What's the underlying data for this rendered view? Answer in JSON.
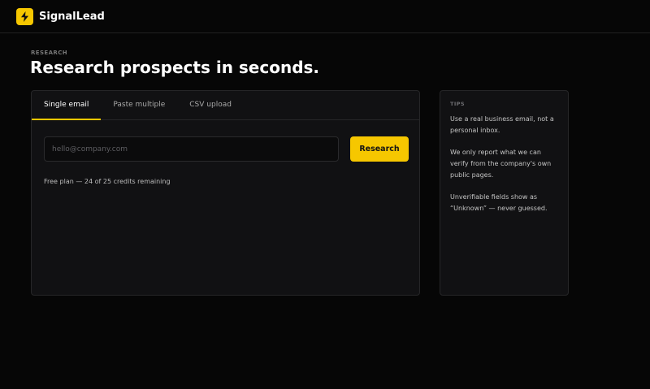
{
  "app": {
    "name": "SignalLead",
    "logo_icon": "lightning-bolt-icon",
    "accent_color": "#f6c700"
  },
  "page": {
    "eyebrow": "RESEARCH",
    "title": "Research prospects in seconds."
  },
  "tabs": [
    {
      "label": "Single email",
      "active": true
    },
    {
      "label": "Paste multiple",
      "active": false
    },
    {
      "label": "CSV upload",
      "active": false
    }
  ],
  "form": {
    "email_value": "",
    "email_placeholder": "hello@company.com",
    "submit_label": "Research",
    "credits_text": "Free plan — 24 of 25 credits remaining"
  },
  "tips": {
    "heading": "TIPS",
    "items": [
      "Use a real business email, not a personal inbox.",
      "We only report what we can verify from the company's own public pages.",
      "Unverifiable fields show as “Unknown” — never guessed."
    ]
  }
}
